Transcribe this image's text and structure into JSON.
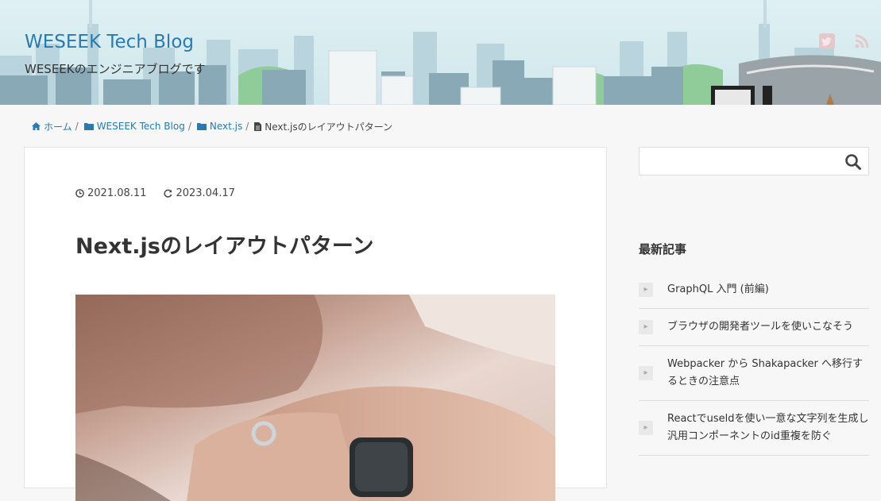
{
  "header": {
    "site_title": "WESEEK Tech Blog",
    "site_description": "WESEEKのエンジニアブログです",
    "icons": [
      "twitter-icon",
      "rss-icon"
    ]
  },
  "breadcrumb": {
    "items": [
      {
        "label": "ホーム",
        "icon": "home-icon"
      },
      {
        "label": "WESEEK Tech Blog",
        "icon": "folder-icon"
      },
      {
        "label": "Next.js",
        "icon": "folder-icon"
      }
    ],
    "separator": "/",
    "current": {
      "label": "Next.jsのレイアウトパターン",
      "icon": "file-icon"
    }
  },
  "article": {
    "published": "2021.08.11",
    "updated": "2023.04.17",
    "title": "Next.jsのレイアウトパターン"
  },
  "sidebar": {
    "search": {
      "placeholder": "",
      "value": ""
    },
    "recent_title": "最新記事",
    "recent_posts": [
      "GraphQL 入門 (前編)",
      "ブラウザの開発者ツールを使いこなそう",
      "Webpacker から Shakapacker へ移行するときの注意点",
      "Reactでuseldを使い一意な文字列を生成し汎用コンポーネントのid重複を防ぐ"
    ]
  },
  "colors": {
    "link": "#2a7ab0",
    "header_sky": "#d6ebef"
  }
}
